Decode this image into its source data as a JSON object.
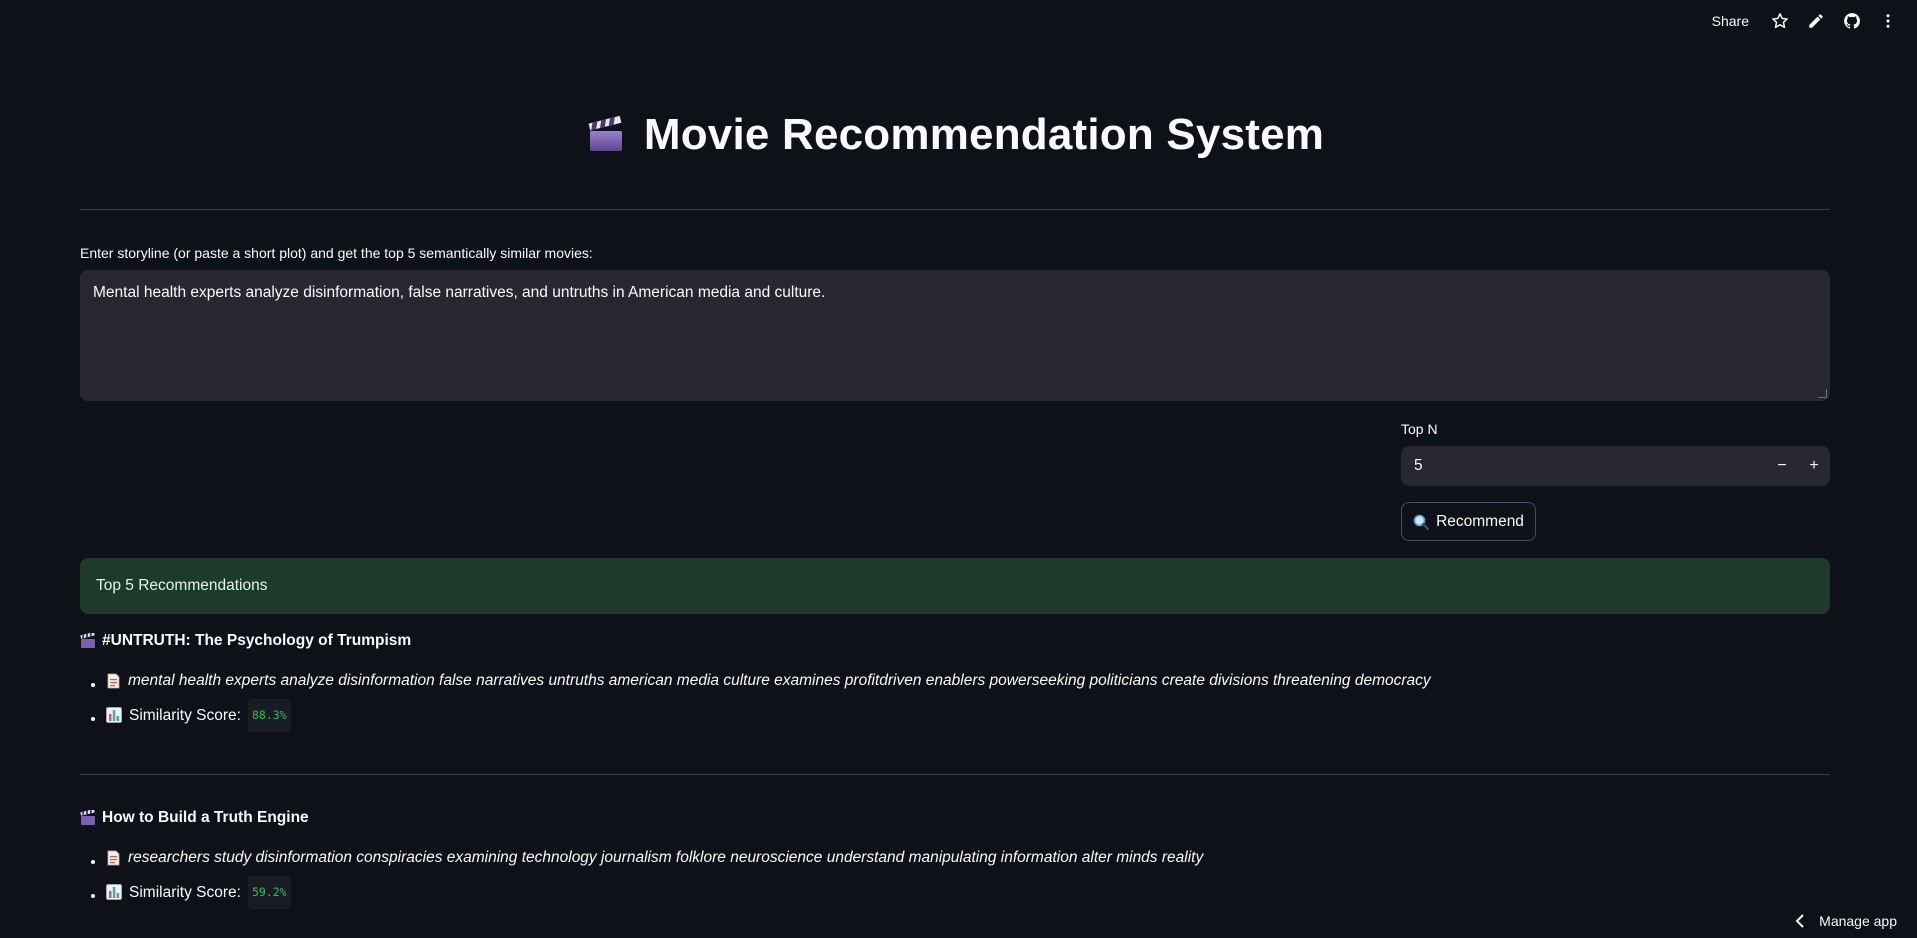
{
  "toolbar": {
    "share_label": "Share"
  },
  "page": {
    "title": "Movie Recommendation System",
    "input_label": "Enter storyline (or paste a short plot) and get the top 5 semantically similar movies:",
    "storyline_value": "Mental health experts analyze disinformation, false narratives, and untruths in American media and culture."
  },
  "topn": {
    "label": "Top N",
    "value": "5",
    "minus": "−",
    "plus": "+"
  },
  "recommend_button": {
    "label": "Recommend"
  },
  "results": {
    "header": "Top 5 Recommendations",
    "score_label": "Similarity Score:",
    "movies": [
      {
        "title": "#UNTRUTH: The Psychology of Trumpism",
        "description": "mental health experts analyze disinformation false narratives untruths american media culture examines profitdriven enablers powerseeking politicians create divisions threatening democracy",
        "score": "88.3%"
      },
      {
        "title": "How to Build a Truth Engine",
        "description": "researchers study disinformation conspiracies examining technology journalism folklore neuroscience understand manipulating information alter minds reality",
        "score": "59.2%"
      }
    ]
  },
  "footer": {
    "manage_label": "Manage app"
  }
}
